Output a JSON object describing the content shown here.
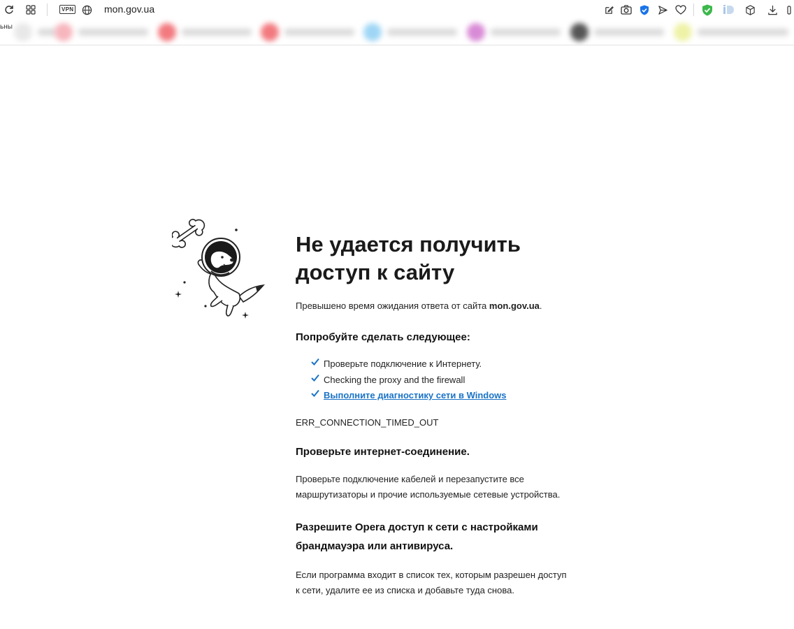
{
  "browser": {
    "url": "mon.gov.ua",
    "vpn_label": "VPN",
    "speed_dial_cut_label": "ьны",
    "speed_dial_colors": [
      "#e8e8e8",
      "#f7b5bd",
      "#f27a7f",
      "#f27a7f",
      "#9fd6f5",
      "#d98ad6",
      "#555555",
      "#eef2a6"
    ]
  },
  "error": {
    "title_line1": "Не удается получить",
    "title_line2": "доступ к сайту",
    "timeout_text": "Превышено время ожидания ответа от сайта ",
    "site": "mon.gov.ua",
    "period": ".",
    "try_heading": "Попробуйте сделать следующее:",
    "suggestions": [
      "Проверьте подключение к Интернету.",
      "Checking the proxy and the firewall",
      "Выполните диагностику сети в Windows"
    ],
    "code": "ERR_CONNECTION_TIMED_OUT",
    "check_heading": "Проверьте интернет-соединение.",
    "check_text_1": "Проверьте подключение кабелей и перезапустите все",
    "check_text_2": "маршрутизаторы и прочие используемые сетевые устройства.",
    "allow_heading_1": "Разрешите Opera доступ к сети с настройками",
    "allow_heading_2": "брандмауэра или антивируса.",
    "allow_text_1": "Если программа входит в список тех, которым разрешен доступ",
    "allow_text_2": "к сети, удалите ее из списка и добавьте туда снова."
  },
  "colors": {
    "link": "#1a73c7",
    "shield_green": "#3cb84b",
    "verified_blue": "#1a73e8"
  }
}
